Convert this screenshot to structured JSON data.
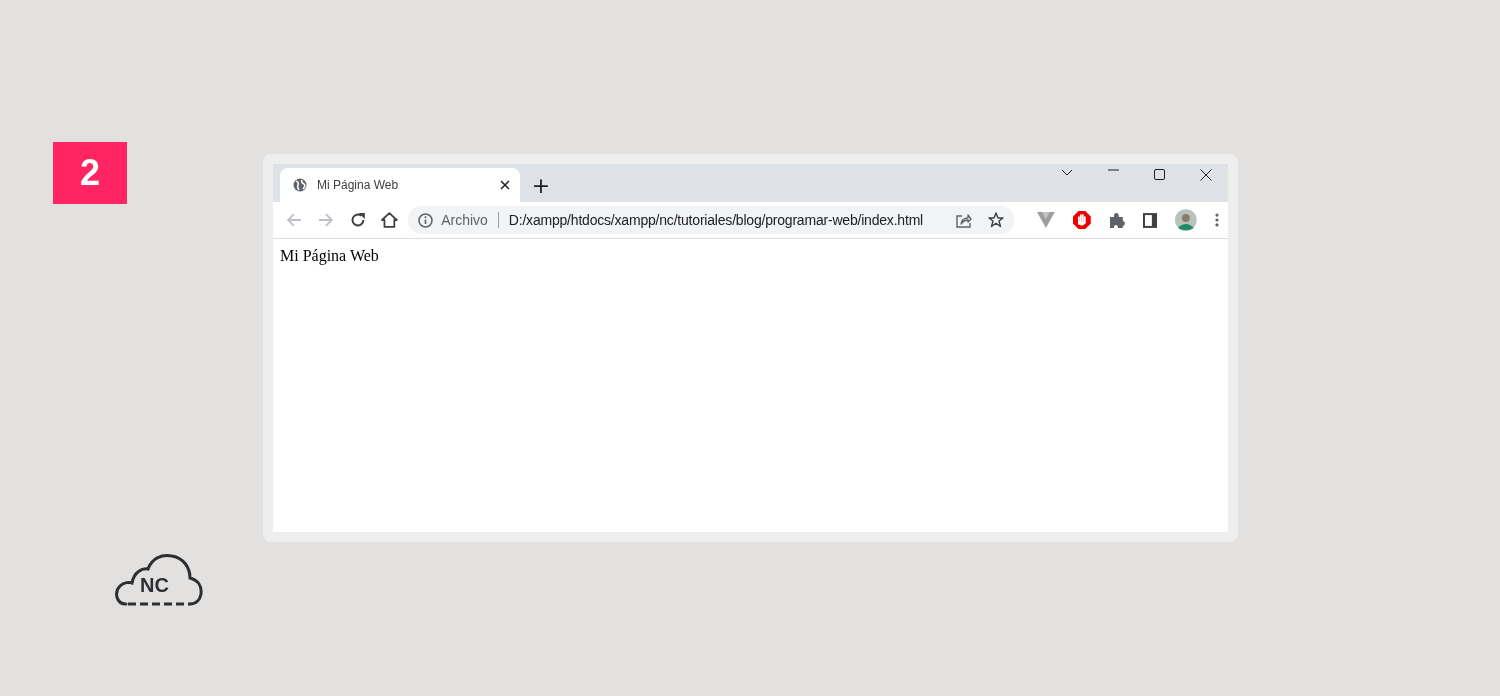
{
  "step_badge": {
    "text": "2"
  },
  "logo": {
    "text": "NC"
  },
  "browser": {
    "tabs": [
      {
        "title": "Mi Página Web",
        "selected": true
      }
    ],
    "new_tab": "+",
    "nav": [
      {
        "kind": "back",
        "disabled": true
      },
      {
        "kind": "forward",
        "disabled": true
      },
      {
        "kind": "reload",
        "disabled": false
      },
      {
        "kind": "home",
        "disabled": false
      }
    ],
    "address": {
      "scheme_label": "Archivo",
      "url": "D:/xampp/htdocs/xampp/nc/tutoriales/blog/programar-web/index.html"
    },
    "extensions": [
      {
        "kind": "vee"
      },
      {
        "kind": "stop"
      },
      {
        "kind": "puzzle"
      },
      {
        "kind": "sidepanel"
      },
      {
        "kind": "avatar"
      },
      {
        "kind": "menu"
      }
    ],
    "content": {
      "text": "Mi Página Web"
    }
  }
}
